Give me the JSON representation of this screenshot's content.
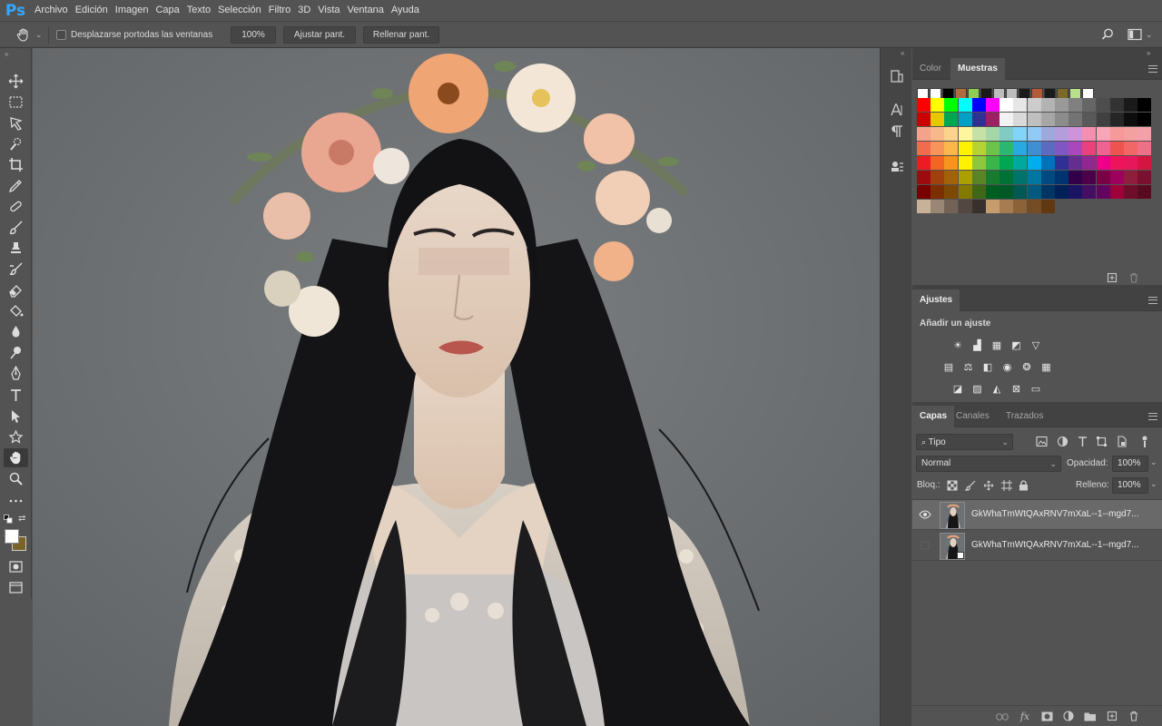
{
  "app": {
    "logo": "Ps"
  },
  "menu": [
    "Archivo",
    "Edición",
    "Imagen",
    "Capa",
    "Texto",
    "Selección",
    "Filtro",
    "3D",
    "Vista",
    "Ventana",
    "Ayuda"
  ],
  "options": {
    "scroll_all_label": "Desplazarse portodas las ventanas",
    "zoom_value": "100%",
    "fit_screen": "Ajustar pant.",
    "fill_screen": "Rellenar pant."
  },
  "color_panel": {
    "tabs": [
      "Color",
      "Muestras"
    ],
    "active_tab": "Muestras",
    "recent_swatches": [
      "#ffffff",
      "#ffffff",
      "#000000",
      "#b06a3e",
      "#8fce54",
      "#1a1a1a",
      "#bdbdbd",
      "#bdbdbd",
      "#1a1a1a",
      "#b35a3b",
      "#1a1a1a",
      "#7a6a26",
      "#b9e08c",
      "#ffffff"
    ],
    "swatch_rows": [
      [
        "#ff0000",
        "#ffff00",
        "#00ff00",
        "#00ffff",
        "#0000ff",
        "#ff00ff",
        "#ffffff",
        "#e6e6e6",
        "#cccccc",
        "#b3b3b3",
        "#999999",
        "#808080",
        "#666666",
        "#4d4d4d",
        "#333333",
        "#1a1a1a",
        "#000000"
      ],
      [
        "#cc0000",
        "#e6c700",
        "#00a651",
        "#00a0c6",
        "#2e3192",
        "#9e1f63",
        "#f2f2f2",
        "#d9d9d9",
        "#bfbfbf",
        "#a6a6a6",
        "#8c8c8c",
        "#737373",
        "#595959",
        "#404040",
        "#262626",
        "#0d0d0d",
        "#000000"
      ],
      [
        "#f4a38b",
        "#f7b98a",
        "#fbd38c",
        "#fff59d",
        "#c5e1a5",
        "#a5d6a7",
        "#80cbc4",
        "#81d4fa",
        "#90caf9",
        "#9fa8da",
        "#b39ddb",
        "#ce93d8",
        "#f48fb1",
        "#f8a5b8",
        "#f59999",
        "#f5a0a0",
        "#f4a0a8"
      ],
      [
        "#f26b4f",
        "#f7945a",
        "#fbb74e",
        "#fff200",
        "#b5d334",
        "#6cc24a",
        "#2bb673",
        "#27aae1",
        "#3f8fd2",
        "#5c6bc0",
        "#7e57c2",
        "#ab47bc",
        "#ec407a",
        "#f06292",
        "#ef5350",
        "#f26665",
        "#f0708a"
      ],
      [
        "#ed1c24",
        "#f26522",
        "#f7941d",
        "#fff200",
        "#8dc63f",
        "#39b54a",
        "#00a651",
        "#00a99d",
        "#00aeef",
        "#0072bc",
        "#2e3192",
        "#662d91",
        "#92278f",
        "#ec008c",
        "#ed145b",
        "#e8175d",
        "#d7143f"
      ],
      [
        "#9e0b0f",
        "#a0410d",
        "#a36209",
        "#aba000",
        "#598527",
        "#197b30",
        "#007236",
        "#00746b",
        "#0076a3",
        "#004a80",
        "#003471",
        "#32004b",
        "#4b0049",
        "#7b0046",
        "#9e005d",
        "#8f1d3c",
        "#7a1030"
      ],
      [
        "#790000",
        "#7b2e00",
        "#7d4900",
        "#827b00",
        "#406618",
        "#005e20",
        "#005826",
        "#005952",
        "#005b7f",
        "#003663",
        "#002157",
        "#1b1464",
        "#440e62",
        "#630460",
        "#9e0039",
        "#6e0e2a",
        "#5a0a20"
      ],
      [
        "#c7b299",
        "#998675",
        "#736357",
        "#534741",
        "#37302d",
        "#c69c6d",
        "#a67c52",
        "#8c6239",
        "#754c24",
        "#603913"
      ]
    ]
  },
  "adjustments": {
    "tab": "Ajustes",
    "heading": "Añadir un ajuste",
    "row1": [
      "brightness-icon",
      "levels-icon",
      "curves-icon",
      "exposure-icon",
      "vibrance-icon"
    ],
    "row2": [
      "hue-saturation-icon",
      "color-balance-icon",
      "black-white-icon",
      "photo-filter-icon",
      "channel-mixer-icon",
      "color-lookup-icon"
    ],
    "row3": [
      "invert-icon",
      "posterize-icon",
      "threshold-icon",
      "selective-color-icon",
      "gradient-map-icon"
    ]
  },
  "layers": {
    "tabs": [
      "Capas",
      "Canales",
      "Trazados"
    ],
    "active_tab": "Capas",
    "filter_kind": "Tipo",
    "blend_mode": "Normal",
    "opacity_label": "Opacidad:",
    "opacity_value": "100%",
    "lock_label": "Bloq.:",
    "fill_label": "Relleno:",
    "fill_value": "100%",
    "items": [
      {
        "name": "GkWhaTmWtQAxRNV7mXaL--1--mgd7...",
        "visible": true,
        "selected": true
      },
      {
        "name": "GkWhaTmWtQAxRNV7mXaL--1--mgd7...",
        "visible": false,
        "selected": false
      }
    ]
  },
  "colors": {
    "foreground": "#ffffff",
    "background": "#7a6428",
    "accent": "#31a8ff"
  }
}
